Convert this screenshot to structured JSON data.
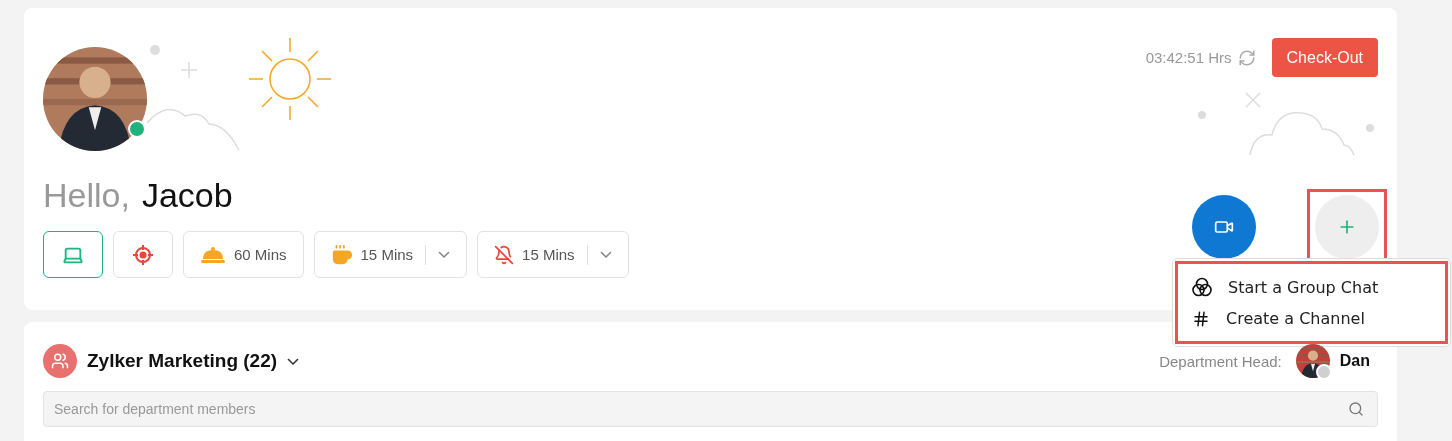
{
  "user": {
    "greeting": "Hello,",
    "name": "Jacob",
    "online": true
  },
  "timer": {
    "time": "03:42:51 Hrs"
  },
  "check_out_button": {
    "label": "Check-Out"
  },
  "status_chips": [
    {
      "kind": "device",
      "selected": true
    },
    {
      "kind": "location",
      "selected": false
    },
    {
      "kind": "lunch",
      "label": "60 Mins",
      "selected": false
    },
    {
      "kind": "tea",
      "label": "15 Mins",
      "selected": false
    },
    {
      "kind": "silent",
      "label": "15 Mins",
      "selected": false
    }
  ],
  "action_buttons": [
    {
      "kind": "video",
      "highlighted": false
    },
    {
      "kind": "add",
      "highlighted": true
    }
  ],
  "add_menu": {
    "highlighted": true,
    "items": [
      {
        "kind": "group",
        "label": "Start a Group Chat"
      },
      {
        "kind": "channel",
        "label": "Create a Channel"
      }
    ]
  },
  "department": {
    "title": "Zylker Marketing (22)",
    "head_label": "Department Head:",
    "head_name": "Dan",
    "head_online": false,
    "search": {
      "placeholder": "Search for department members"
    }
  }
}
